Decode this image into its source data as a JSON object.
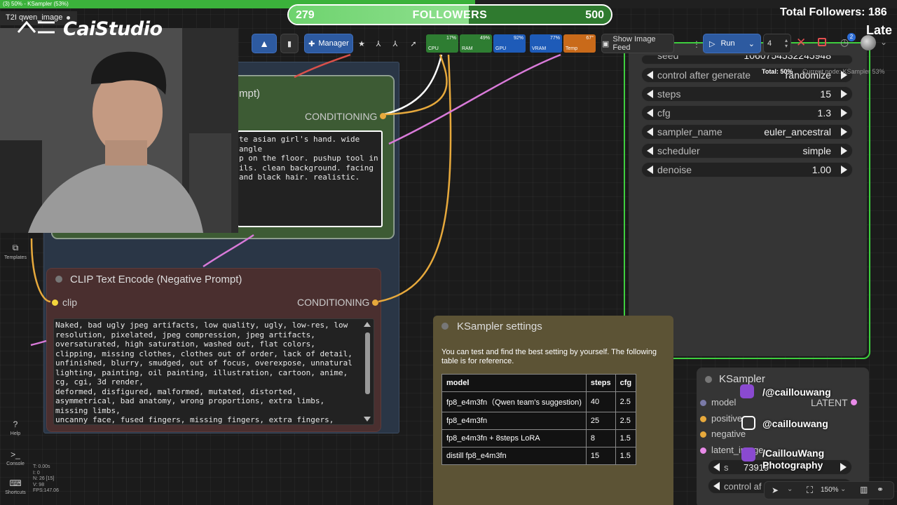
{
  "window": {
    "tab_title": "(3) 50% - KSampler (53%)",
    "progress": 0.53,
    "workflow_tab": "T2I qwen_image",
    "workflow_tab_close": "✕"
  },
  "overlay": {
    "brand": "CaiStudio",
    "followers_current": "279",
    "followers_label": "FOLLOWERS",
    "followers_goal": "500",
    "followers_progress": 0.558,
    "total_followers": "Total Followers: 186",
    "latest": "Late",
    "socials": [
      {
        "icon": "youtube-icon",
        "text": "/@caillouwang"
      },
      {
        "icon": "instagram-icon",
        "text": "@caillouwang"
      },
      {
        "icon": "facebook-icon",
        "text": "/CaillouWang Photography"
      }
    ]
  },
  "toolbar": {
    "manager_label": "Manager",
    "meters": [
      {
        "label": "CPU",
        "value": "17%",
        "color": "#2e7d32"
      },
      {
        "label": "RAM",
        "value": "49%",
        "color": "#2e7d32"
      },
      {
        "label": "GPU",
        "value": "92%",
        "color": "#1e5bb8"
      },
      {
        "label": "VRAM",
        "value": "77%",
        "color": "#1e5bb8"
      },
      {
        "label": "Temp",
        "value": "67°",
        "color": "#c96a1a"
      }
    ],
    "image_feed_label": "Show Image Feed",
    "run_label": "Run",
    "batch_count": "4",
    "queue_badge": "2"
  },
  "status": {
    "total": "Total: 50%",
    "current_node": "Current node: KSampler 53%"
  },
  "positive_node": {
    "title_fragment": "mpt)",
    "output_label": "CONDITIONING",
    "text": "te asian girl's hand. wide angle\np on the floor. pushup tool in\nils. clean background. facing\nand black hair. realistic."
  },
  "negative_node": {
    "title": "CLIP Text Encode (Negative Prompt)",
    "input_label": "clip",
    "output_label": "CONDITIONING",
    "text": "Naked, bad ugly jpeg artifacts, low quality, ugly, low-res, low resolution, pixelated, jpeg compression, jpeg artifacts, oversaturated, high saturation, washed out, flat colors, clipping, missing clothes, clothes out of order, lack of detail, unfinished, blurry, smudged, out of focus, overexpose, unnatural lighting, painting, oil painting, illustration, cartoon, anime, cg, cgi, 3d render,\ndeformed, disfigured, malformed, mutated, distorted, asymmetrical, bad anatomy, wrong proportions, extra limbs, missing limbs,\nuncanny face, fused fingers, missing fingers, extra fingers,\nfabric error, texture error, clipping, floating clothes, missing"
  },
  "ksampler_main": {
    "widgets": [
      {
        "label": "seed",
        "value": "1060754532245948"
      },
      {
        "label": "control after generate",
        "value": "randomize"
      },
      {
        "label": "steps",
        "value": "15"
      },
      {
        "label": "cfg",
        "value": "1.3"
      },
      {
        "label": "sampler_name",
        "value": "euler_ancestral"
      },
      {
        "label": "scheduler",
        "value": "simple"
      },
      {
        "label": "denoise",
        "value": "1.00"
      }
    ]
  },
  "note": {
    "title": "KSampler settings",
    "description": "You can test and find the best setting by yourself. The following table is for reference.",
    "headers": [
      "model",
      "steps",
      "cfg"
    ],
    "rows": [
      [
        "fp8_e4m3fn（Qwen team's suggestion)",
        "40",
        "2.5"
      ],
      [
        "fp8_e4m3fn",
        "25",
        "2.5"
      ],
      [
        "fp8_e4m3fn + 8steps LoRA",
        "8",
        "1.5"
      ],
      [
        "distill fp8_e4m3fn",
        "15",
        "1.5"
      ]
    ]
  },
  "ksampler_small": {
    "title": "KSampler",
    "inputs": [
      "model",
      "positive",
      "negative",
      "latent_image"
    ],
    "output": "LATENT",
    "seed_partial": "73919",
    "widget_s": "s",
    "widget_control": "control af"
  },
  "sidebar": {
    "items": [
      "Templates",
      "Help",
      "Console",
      "Shortcuts"
    ]
  },
  "stats": {
    "lines": [
      "T: 0.00s",
      "I: 0",
      "N: 26 [15]",
      "V: 98",
      "FPS:147.06"
    ]
  },
  "canvas": {
    "zoom": "150%"
  },
  "colors": {
    "positive_node": "#3d5b34",
    "negative_node": "#4a2f2f",
    "note_node": "#5c5335",
    "group_blue": "#2a3646",
    "link_yellow": "#e7a93c",
    "link_pink": "#d97ad9",
    "link_white": "#ffffff",
    "running_outline": "#3ecf3e"
  }
}
